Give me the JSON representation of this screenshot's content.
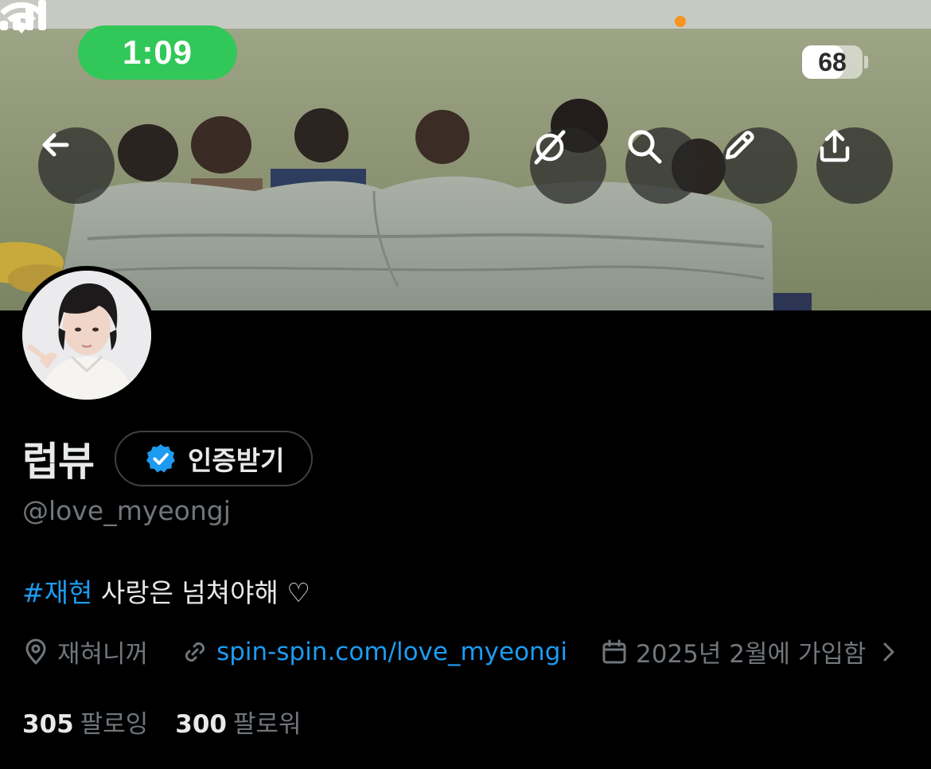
{
  "status_bar": {
    "time": "1:09",
    "battery": "68",
    "battery_level_percent": 68
  },
  "header_buttons": {
    "back": "arrow-left-icon",
    "grok": "grok-icon",
    "search": "search-icon",
    "edit": "pencil-icon",
    "share": "share-icon"
  },
  "profile": {
    "display_name": "럽뷰",
    "verify_label": "인증받기",
    "handle": "@love_myeongj",
    "bio_hashtag": "#재현",
    "bio_text": " 사랑은 넘쳐야해 ♡",
    "location": "재혀니꺼",
    "website": "spin-spin.com/love_myeongi",
    "joined": "2025년 2월에 가입함",
    "following_count": "305",
    "following_label": "팔로잉",
    "followers_count": "300",
    "followers_label": "팔로워"
  },
  "colors": {
    "accent": "#1d9bf0",
    "status_green": "#32c759",
    "background": "#000000",
    "muted_text": "#71767b"
  }
}
